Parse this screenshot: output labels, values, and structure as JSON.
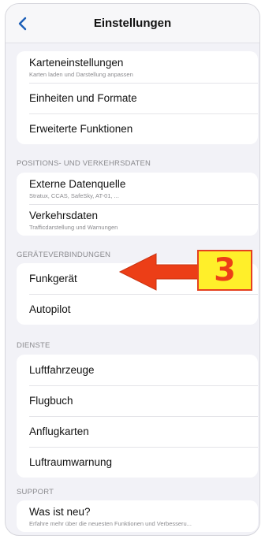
{
  "nav": {
    "title": "Einstellungen"
  },
  "groups": {
    "general": {
      "items": [
        {
          "title": "Karteneinstellungen",
          "subtitle": "Karten laden und Darstellung anpassen"
        },
        {
          "title": "Einheiten und Formate"
        },
        {
          "title": "Erweiterte Funktionen"
        }
      ]
    },
    "positions": {
      "header": "POSITIONS- UND VERKEHRSDATEN",
      "items": [
        {
          "title": "Externe Datenquelle",
          "subtitle": "Stratux, CCAS, SafeSky, AT-01, ..."
        },
        {
          "title": "Verkehrsdaten",
          "subtitle": "Trafficdarstellung und Warnungen"
        }
      ]
    },
    "devices": {
      "header": "GERÄTEVERBINDUNGEN",
      "items": [
        {
          "title": "Funkgerät"
        },
        {
          "title": "Autopilot"
        }
      ]
    },
    "services": {
      "header": "DIENSTE",
      "items": [
        {
          "title": "Luftfahrzeuge"
        },
        {
          "title": "Flugbuch"
        },
        {
          "title": "Anflugkarten"
        },
        {
          "title": "Luftraumwarnung"
        }
      ]
    },
    "support": {
      "header": "SUPPORT",
      "items": [
        {
          "title": "Was ist neu?",
          "subtitle": "Erfahre mehr über die neuesten Funktionen und Verbesseru..."
        }
      ]
    }
  },
  "annotation": {
    "number": "3",
    "arrow_color": "#ec3e17",
    "box_color": "#ffef2a"
  },
  "colors": {
    "accent": "#1c5fb8",
    "background": "#f2f2f7"
  }
}
